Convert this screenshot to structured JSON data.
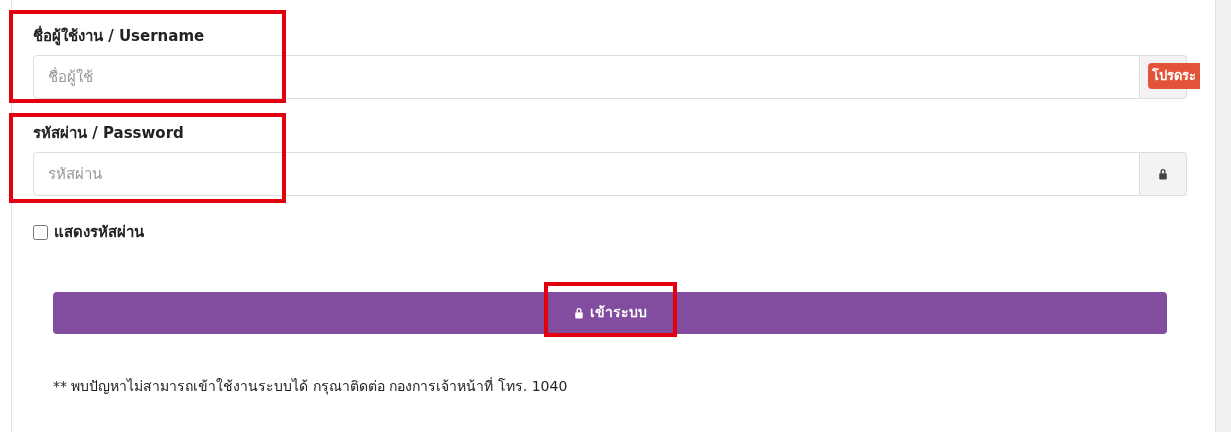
{
  "username": {
    "label": "ชื่อผู้ใช้งาน / Username",
    "placeholder": "ชื่อผู้ใช้",
    "badge": "โปรดระ"
  },
  "password": {
    "label": "รหัสผ่าน / Password",
    "placeholder": "รหัสผ่าน"
  },
  "show_password": {
    "label": "แสดงรหัสผ่าน",
    "checked": false
  },
  "login_button": {
    "label": "เข้าระบบ"
  },
  "note": "** พบปัญหาไม่สามารถเข้าใช้งานระบบได้ กรุณาติดต่อ กองการเจ้าหน้าที่ โทร. 1040"
}
